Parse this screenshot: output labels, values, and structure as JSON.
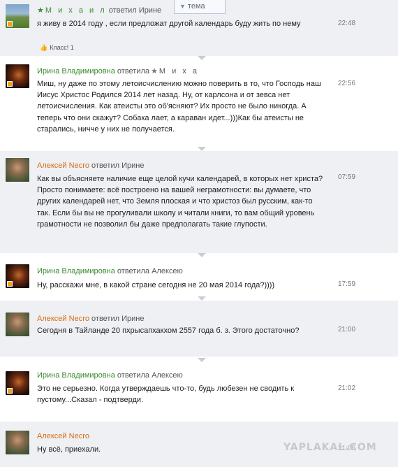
{
  "thread_button": {
    "label": "тема",
    "icon": "triangle-down-icon"
  },
  "comments": [
    {
      "author": "М и х а и л",
      "verb": "ответил",
      "addressee": "Ирине",
      "text": "я живу в 2014 году , если предложат другой календарь буду жить по нему",
      "time": "22:48",
      "likes": "Класс! 1"
    },
    {
      "author": "Ирина Владимировна",
      "verb": "ответила",
      "addressee": "М и х а",
      "text": "Миш, ну даже по этому летоисчислению можно поверить в то, что Господь наш Иисус Христос Родился 2014 лет назад. Ну, от карлсона и от зевса нет летоисчисления. Как атеисты это об'ясняют? Их просто не было никогда. А теперь что они скажут? Собака лает, а караван идет...)))Как бы атеисты не старались, ничче у них не получается.",
      "time": "22:56"
    },
    {
      "author": "Алексей Necro",
      "verb": "ответил",
      "addressee": "Ирине",
      "text": "Как вы объясняете наличие еще целой кучи календарей, в которых нет христа? Просто понимаете: всё построено на вашей неграмотности: вы думаете, что других календарей нет, что Земля плоская и что христоз был русским,  как-то так. Если бы вы не прогуливали школу и читали книги, то вам общий уровень грамотности не позволил бы даже предполагать такие глупости.",
      "time": "07:59"
    },
    {
      "author": "Ирина Владимировна",
      "verb": "ответила",
      "addressee": "Алексею",
      "text": "Ну, расскажи мне, в какой стране сегодня не 20 мая 2014 года?))))",
      "time": "17:59"
    },
    {
      "author": "Алексей Necro",
      "verb": "ответил",
      "addressee": "Ирине",
      "text": "Сегодня в Тайланде 20 пхрысапхакхом 2557 года б. з. Этого достаточно?",
      "time": "21:00"
    },
    {
      "author": "Ирина Владимировна",
      "verb": "ответила",
      "addressee": "Алексею",
      "text": "Это не серьезно. Когда утверждаешь что-то, будь любезен не сводить к пустому...Сказал - подтверди.",
      "time": "21:02"
    },
    {
      "author": "Алексей Necro",
      "verb": "",
      "addressee": "",
      "text": "Ну всё, приехали.",
      "time": "21:06"
    }
  ],
  "watermark": "YAPLAKAL.COM",
  "colors": {
    "name_green": "#3b8b2f",
    "name_orange": "#d86d12",
    "row_shade": "#eef0f4"
  }
}
